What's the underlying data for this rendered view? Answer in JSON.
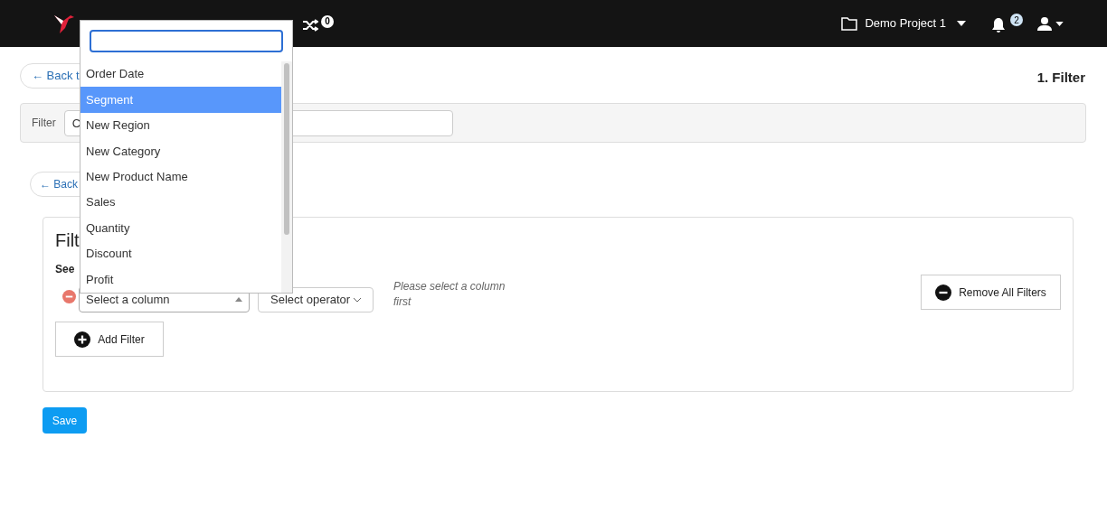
{
  "navbar": {
    "shuffle_count": "0",
    "project": "Demo Project 1",
    "notification_count": "2"
  },
  "back_button_top": "← Back t",
  "step_title": "1. Filter",
  "filter_bar": {
    "label": "Filter",
    "value": "C"
  },
  "back_button_inner": "← Back",
  "card": {
    "heading": "Filt",
    "description": "See",
    "rows": [
      {
        "column_placeholder": "Select a column",
        "operator_placeholder": "Select operator",
        "hint": "Please select a column first"
      }
    ],
    "remove_all": "Remove All Filters",
    "add": "Add Filter"
  },
  "save": "Save",
  "dropdown": {
    "options": [
      {
        "label": "Order Date",
        "selected": false
      },
      {
        "label": "Segment",
        "selected": true
      },
      {
        "label": "New Region",
        "selected": false
      },
      {
        "label": "New Category",
        "selected": false
      },
      {
        "label": "New Product Name",
        "selected": false
      },
      {
        "label": "Sales",
        "selected": false
      },
      {
        "label": "Quantity",
        "selected": false
      },
      {
        "label": "Discount",
        "selected": false
      },
      {
        "label": "Profit",
        "selected": false
      }
    ]
  }
}
